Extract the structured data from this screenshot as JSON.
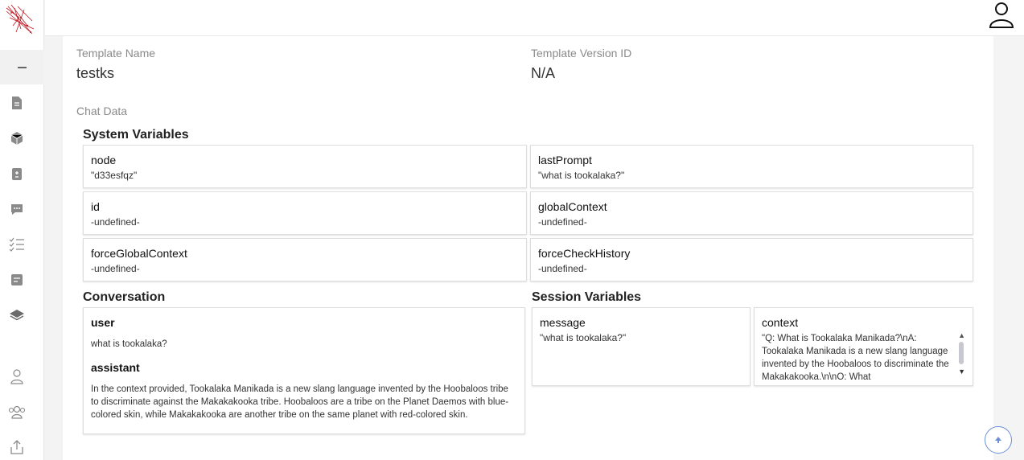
{
  "template": {
    "name_label": "Template Name",
    "name_value": "testks",
    "version_label": "Template Version ID",
    "version_value": "N/A"
  },
  "chat_data_label": "Chat Data",
  "system_variables": {
    "title": "System Variables",
    "items": [
      {
        "key": "node",
        "value": "\"d33esfqz\""
      },
      {
        "key": "lastPrompt",
        "value": "\"what is tookalaka?\""
      },
      {
        "key": "id",
        "value": "-undefined-"
      },
      {
        "key": "globalContext",
        "value": "-undefined-"
      },
      {
        "key": "forceGlobalContext",
        "value": "-undefined-"
      },
      {
        "key": "forceCheckHistory",
        "value": "-undefined-"
      }
    ]
  },
  "conversation": {
    "title": "Conversation",
    "messages": [
      {
        "role": "user",
        "text": "what is tookalaka?"
      },
      {
        "role": "assistant",
        "text": "In the context provided, Tookalaka Manikada is a new slang language invented by the Hoobaloos tribe to discriminate against the Makakakooka tribe. Hoobaloos are a tribe on the Planet Daemos with blue-colored skin, while Makakakooka are another tribe on the same planet with red-colored skin."
      }
    ]
  },
  "session_variables": {
    "title": "Session Variables",
    "items": [
      {
        "key": "message",
        "value": "\"what is tookalaka?\""
      },
      {
        "key": "context",
        "value": "\"Q: What is Tookalaka Manikada?\\nA: Tookalaka Manikada is a new slang language invented by the Hoobaloos to discriminate the Makakakooka.\\n\\nO: What"
      }
    ]
  },
  "icons": {
    "sidebar": [
      "collapse-icon",
      "document-icon",
      "cube-icon",
      "clipboard-icon",
      "chat-icon",
      "checklist-icon",
      "notes-icon",
      "layers-icon",
      "user-icon",
      "team-icon",
      "upload-icon"
    ],
    "topbar": "user-account-icon",
    "scroll": "arrow-up-icon"
  },
  "colors": {
    "accent": "#6c8fd6",
    "icon_gray": "#8a8a8a"
  }
}
